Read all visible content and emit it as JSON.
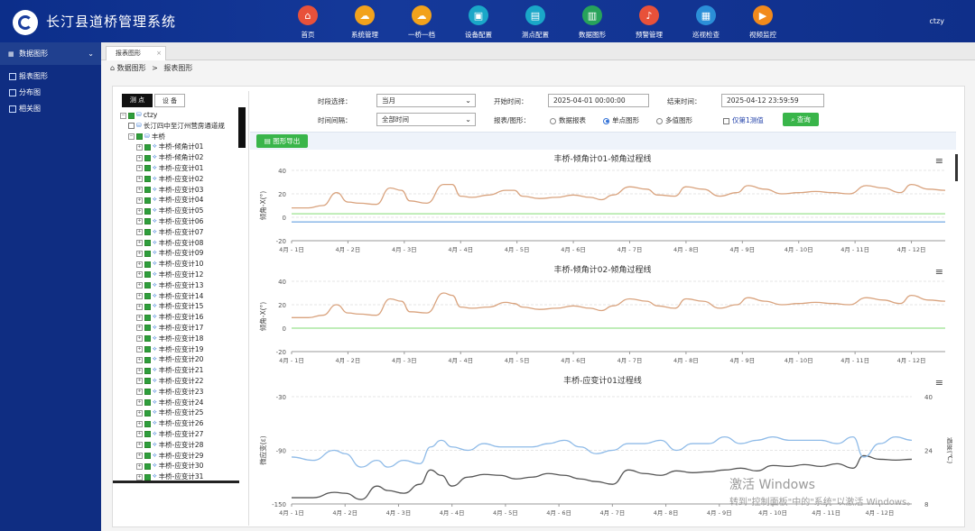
{
  "app": {
    "title": "长汀县道桥管理系统",
    "user": "ctzy"
  },
  "topnav": [
    {
      "label": "首页",
      "icon": "home-icon",
      "color": "#e8513a",
      "glyph": "⌂"
    },
    {
      "label": "系统管理",
      "icon": "cloud-icon",
      "color": "#f2a21c",
      "glyph": "☁"
    },
    {
      "label": "一桥一档",
      "icon": "cloud-icon",
      "color": "#f2a21c",
      "glyph": "☁"
    },
    {
      "label": "设备配置",
      "icon": "briefcase-icon",
      "color": "#1aa7c8",
      "glyph": "▣"
    },
    {
      "label": "测点配置",
      "icon": "image-icon",
      "color": "#1aa7c8",
      "glyph": "▤"
    },
    {
      "label": "数据图形",
      "icon": "bar-chart-icon",
      "color": "#27a35b",
      "glyph": "▥"
    },
    {
      "label": "预警管理",
      "icon": "bell-icon",
      "color": "#e8513a",
      "glyph": "♪"
    },
    {
      "label": "巡视检查",
      "icon": "document-icon",
      "color": "#2b8fd8",
      "glyph": "▦"
    },
    {
      "label": "视频监控",
      "icon": "video-icon",
      "color": "#f28a1c",
      "glyph": "▶"
    }
  ],
  "sidebar": {
    "header": "数据图形",
    "items": [
      {
        "label": "报表图形"
      },
      {
        "label": "分布图"
      },
      {
        "label": "相关图"
      }
    ]
  },
  "tabs": [
    {
      "label": "报表图形"
    }
  ],
  "breadcrumb": {
    "home": "数据图形",
    "sep": ">",
    "current": "报表图形"
  },
  "tree": {
    "tabs": [
      "测 点",
      "设 备"
    ],
    "root": "ctzy",
    "nodes": [
      "长汀四中至汀州营房通道规",
      "丰桥"
    ],
    "children": [
      "丰桥-倾角计01",
      "丰桥-倾角计02",
      "丰桥-应变计01",
      "丰桥-应变计02",
      "丰桥-应变计03",
      "丰桥-应变计04",
      "丰桥-应变计05",
      "丰桥-应变计06",
      "丰桥-应变计07",
      "丰桥-应变计08",
      "丰桥-应变计09",
      "丰桥-应变计10",
      "丰桥-应变计12",
      "丰桥-应变计13",
      "丰桥-应变计14",
      "丰桥-应变计15",
      "丰桥-应变计16",
      "丰桥-应变计17",
      "丰桥-应变计18",
      "丰桥-应变计19",
      "丰桥-应变计20",
      "丰桥-应变计21",
      "丰桥-应变计22",
      "丰桥-应变计23",
      "丰桥-应变计24",
      "丰桥-应变计25",
      "丰桥-应变计26",
      "丰桥-应变计27",
      "丰桥-应变计28",
      "丰桥-应变计29",
      "丰桥-应变计30",
      "丰桥-应变计31"
    ]
  },
  "filters": {
    "period_label": "时段选择：",
    "period_value": "当月",
    "interval_label": "时间间隔：",
    "interval_value": "全部时间",
    "start_label": "开始时间：",
    "start_value": "2025-04-01 00:00:00",
    "end_label": "结束时间：",
    "end_value": "2025-04-12 23:59:59",
    "mode_label": "报表/图形：",
    "modes": [
      "数据报表",
      "单点图形",
      "多值图形"
    ],
    "mode_selected": 1,
    "first_only": "仅第1测值",
    "query": "查询",
    "export": "图形导出"
  },
  "chart_data": [
    {
      "type": "line",
      "title": "丰桥-倾角计01-倾角过程线",
      "ylabel": "倾角-X(°)",
      "ylim": [
        -20,
        40
      ],
      "yticks": [
        -20,
        0,
        20,
        40
      ],
      "xticks": [
        "4月 - 1日",
        "4月 - 2日",
        "4月 - 3日",
        "4月 - 4日",
        "4月 - 5日",
        "4月 - 6日",
        "4月 - 7日",
        "4月 - 8日",
        "4月 - 9日",
        "4月 - 10日",
        "4月 - 11日",
        "4月 - 12日"
      ],
      "xlim": [
        0,
        11.6
      ],
      "grid": true,
      "series": [
        {
          "color": "#d9a37e",
          "x": [
            0,
            0.3,
            0.55,
            0.8,
            1.0,
            1.2,
            1.5,
            1.75,
            1.95,
            2.1,
            2.4,
            2.7,
            2.85,
            3.0,
            3.2,
            3.5,
            3.8,
            3.95,
            4.1,
            4.4,
            4.7,
            5.0,
            5.3,
            5.5,
            5.7,
            6.0,
            6.3,
            6.5,
            6.8,
            7.0,
            7.3,
            7.6,
            7.9,
            8.1,
            8.4,
            8.7,
            9.0,
            9.3,
            9.6,
            9.9,
            10.2,
            10.5,
            10.8,
            11.0,
            11.3,
            11.6
          ],
          "values": [
            8,
            8,
            10,
            21,
            13,
            12,
            11,
            25,
            23,
            14,
            12,
            28,
            28,
            18,
            17,
            19,
            23,
            23,
            18,
            16,
            17,
            19,
            17,
            15,
            19,
            26,
            24,
            19,
            18,
            26,
            24,
            18,
            21,
            27,
            24,
            20,
            21,
            22,
            21,
            20,
            27,
            25,
            21,
            28,
            24,
            23
          ]
        },
        {
          "color": "#9be28f",
          "x": [
            0,
            11.6
          ],
          "values": [
            3,
            3
          ]
        },
        {
          "color": "#7fb0e6",
          "x": [
            0,
            11.6
          ],
          "values": [
            -4,
            -4
          ]
        }
      ]
    },
    {
      "type": "line",
      "title": "丰桥-倾角计02-倾角过程线",
      "ylabel": "倾角-X(°)",
      "ylim": [
        -20,
        40
      ],
      "yticks": [
        -20,
        0,
        20,
        40
      ],
      "xticks": [
        "4月 - 1日",
        "4月 - 2日",
        "4月 - 3日",
        "4月 - 4日",
        "4月 - 5日",
        "4月 - 6日",
        "4月 - 7日",
        "4月 - 8日",
        "4月 - 9日",
        "4月 - 10日",
        "4月 - 11日",
        "4月 - 12日"
      ],
      "xlim": [
        0,
        11.6
      ],
      "grid": true,
      "series": [
        {
          "color": "#d9a37e",
          "x": [
            0,
            0.3,
            0.55,
            0.8,
            1.0,
            1.2,
            1.5,
            1.75,
            1.95,
            2.1,
            2.4,
            2.7,
            2.85,
            3.0,
            3.2,
            3.5,
            3.8,
            3.95,
            4.1,
            4.4,
            4.7,
            5.0,
            5.3,
            5.5,
            5.7,
            6.0,
            6.3,
            6.5,
            6.8,
            7.0,
            7.3,
            7.6,
            7.9,
            8.1,
            8.4,
            8.7,
            9.0,
            9.3,
            9.6,
            9.9,
            10.2,
            10.5,
            10.8,
            11.0,
            11.3,
            11.6
          ],
          "values": [
            9,
            9,
            11,
            20,
            13,
            12,
            11,
            25,
            23,
            14,
            13,
            30,
            28,
            18,
            17,
            18,
            22,
            21,
            18,
            16,
            17,
            19,
            17,
            15,
            19,
            25,
            23,
            19,
            17,
            25,
            23,
            17,
            20,
            26,
            23,
            20,
            21,
            22,
            21,
            20,
            26,
            24,
            21,
            28,
            24,
            23
          ]
        },
        {
          "color": "#9be28f",
          "x": [
            0,
            11.6
          ],
          "values": [
            0,
            0
          ]
        }
      ]
    },
    {
      "type": "line",
      "title": "丰桥-应变计01过程线",
      "ylabel": "微应变(ε)",
      "ylabel_right": "温度(℃)",
      "ylim": [
        -150,
        -30
      ],
      "yticks": [
        -150,
        -90,
        -30
      ],
      "ylim_right": [
        8,
        40
      ],
      "yticks_right": [
        8,
        24,
        40
      ],
      "xticks": [
        "4月 - 1日",
        "4月 - 2日",
        "4月 - 3日",
        "4月 - 4日",
        "4月 - 5日",
        "4月 - 6日",
        "4月 - 7日",
        "4月 - 8日",
        "4月 - 9日",
        "4月 - 10日",
        "4月 - 11日",
        "4月 - 12日"
      ],
      "xlim": [
        0,
        11.6
      ],
      "grid": true,
      "series": [
        {
          "color": "#555555",
          "axis": "left",
          "x": [
            0,
            0.4,
            0.8,
            1.0,
            1.3,
            1.6,
            1.8,
            2.1,
            2.4,
            2.6,
            2.8,
            3.0,
            3.3,
            3.6,
            3.9,
            4.2,
            4.5,
            4.8,
            5.1,
            5.4,
            5.7,
            6.0,
            6.3,
            6.6,
            6.9,
            7.2,
            7.5,
            7.8,
            8.1,
            8.4,
            8.7,
            9.0,
            9.3,
            9.6,
            9.9,
            10.2,
            10.5,
            10.7,
            11.0,
            11.3,
            11.6
          ],
          "values": [
            -143,
            -143,
            -137,
            -138,
            -145,
            -130,
            -135,
            -138,
            -128,
            -112,
            -118,
            -130,
            -120,
            -117,
            -118,
            -122,
            -120,
            -116,
            -118,
            -122,
            -125,
            -128,
            -112,
            -116,
            -118,
            -113,
            -115,
            -114,
            -112,
            -110,
            -113,
            -107,
            -108,
            -106,
            -108,
            -105,
            -110,
            -96,
            -100,
            -101,
            -100
          ]
        },
        {
          "color": "#8fbbe8",
          "axis": "right",
          "x": [
            0,
            0.4,
            0.8,
            1.0,
            1.3,
            1.6,
            1.8,
            2.1,
            2.4,
            2.6,
            2.8,
            3.0,
            3.3,
            3.6,
            3.9,
            4.2,
            4.5,
            4.8,
            5.1,
            5.4,
            5.7,
            6.0,
            6.3,
            6.6,
            6.9,
            7.2,
            7.5,
            7.8,
            8.1,
            8.4,
            8.7,
            9.0,
            9.3,
            9.6,
            9.9,
            10.2,
            10.5,
            10.7,
            11.0,
            11.3,
            11.6
          ],
          "values": [
            22,
            21,
            24,
            23,
            19,
            21,
            19,
            21,
            20,
            25,
            27,
            25,
            24,
            26,
            25,
            25,
            25,
            26,
            27,
            25,
            23,
            24,
            26,
            26,
            27,
            24,
            26,
            26,
            28,
            26,
            27,
            28,
            27,
            27,
            27,
            26,
            28,
            22,
            26,
            28,
            27
          ]
        }
      ]
    }
  ],
  "watermark": {
    "line1": "激活 Windows",
    "line2": "转到\"控制面板\"中的\"系统\"以激活 Windows。"
  }
}
